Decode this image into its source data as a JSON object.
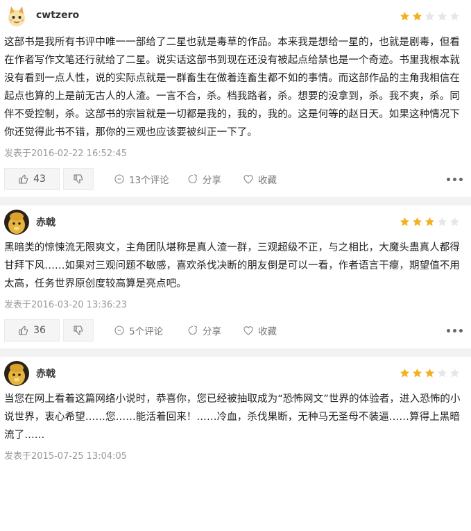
{
  "reviews": [
    {
      "user": "cwtzero",
      "rating": 2,
      "content": "这部书是我所有书评中唯一一部给了二星也就是毒草的作品。本来我是想给一星的，也就是剧毒，但看在作者写作文笔还行就给了二星。说实话这部书到现在还没有被起点给禁也是一个奇迹。书里我根本就没有看到一点人性，说的实际点就是一群畜生在做着连畜生都不如的事情。而这部作品的主角我相信在起点也算的上是前无古人的人渣。一言不合，杀。档我路者，杀。想要的没拿到，杀。我不爽，杀。同伴不受控制，杀。这部书的宗旨就是一切都是我的，我的，我的。这是何等的赵日天。如果这种情况下你还觉得此书不错，那你的三观也应该要被纠正一下了。",
      "time": "发表于2016-02-22 16:52:45",
      "likes": "43",
      "comments": "13个评论",
      "share": "分享",
      "favorite": "收藏"
    },
    {
      "user": "赤戟",
      "rating": 3,
      "content": "黑暗类的惊悚流无限爽文，主角团队堪称是真人渣一群，三观超级不正，与之相比，大魔头蛊真人都得甘拜下风……如果对三观问题不敏感，喜欢杀伐决断的朋友倒是可以一看，作者语言干瘪，期望值不用太高，任务世界原创度较高算是亮点吧。",
      "time": "发表于2016-03-20 13:36:23",
      "likes": "36",
      "comments": "5个评论",
      "share": "分享",
      "favorite": "收藏"
    },
    {
      "user": "赤戟",
      "rating": 3,
      "content": "当您在网上看着这篇网络小说时，恭喜你，您已经被抽取成为“恐怖网文”世界的体验者，进入恐怖的小说世界，衷心希望……您……能活着回来！……冷血，杀伐果断，无种马无圣母不装逼……算得上黑暗流了……",
      "time": "发表于2015-07-25 13:04:05"
    }
  ],
  "colors": {
    "star_on": "#f5b021",
    "star_off": "#e6e6e6"
  }
}
